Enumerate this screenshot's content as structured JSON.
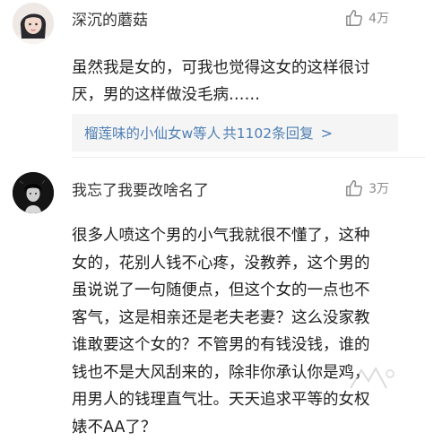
{
  "comments": [
    {
      "username": "深沉的蘑菇",
      "like_count": "4万",
      "lines": [
        "虽然我是女的，可我也觉得这女的这样很讨",
        "厌，男的这样做没毛病……"
      ],
      "reply": {
        "user": "榴莲味的小仙女w等人",
        "text": "共1102条回复",
        "arrow": ">"
      }
    },
    {
      "username": "我忘了我要改啥名了",
      "like_count": "3万",
      "lines": [
        "很多人喷这个男的小气我就很不懂了，这种",
        "女的，花别人钱不心疼，没教养，这个男的",
        "虽说说了一句随便点，但这个女的一点也不",
        "客气，这是相亲还是老夫老妻？这么没家教",
        "谁敢要这个女的？不管男的有钱没钱，谁的",
        "钱也不是大风刮来的，除非你承认你是鸡，",
        "用男人的钱理直气壮。天天追求平等的女权",
        "婊不AA了？"
      ]
    }
  ],
  "colors": {
    "link": "#4f7fb5",
    "muted": "#8a8a8a",
    "reply_bg": "#f5f5f5"
  },
  "icons": {
    "like": "thumbs-up-outline-icon"
  }
}
